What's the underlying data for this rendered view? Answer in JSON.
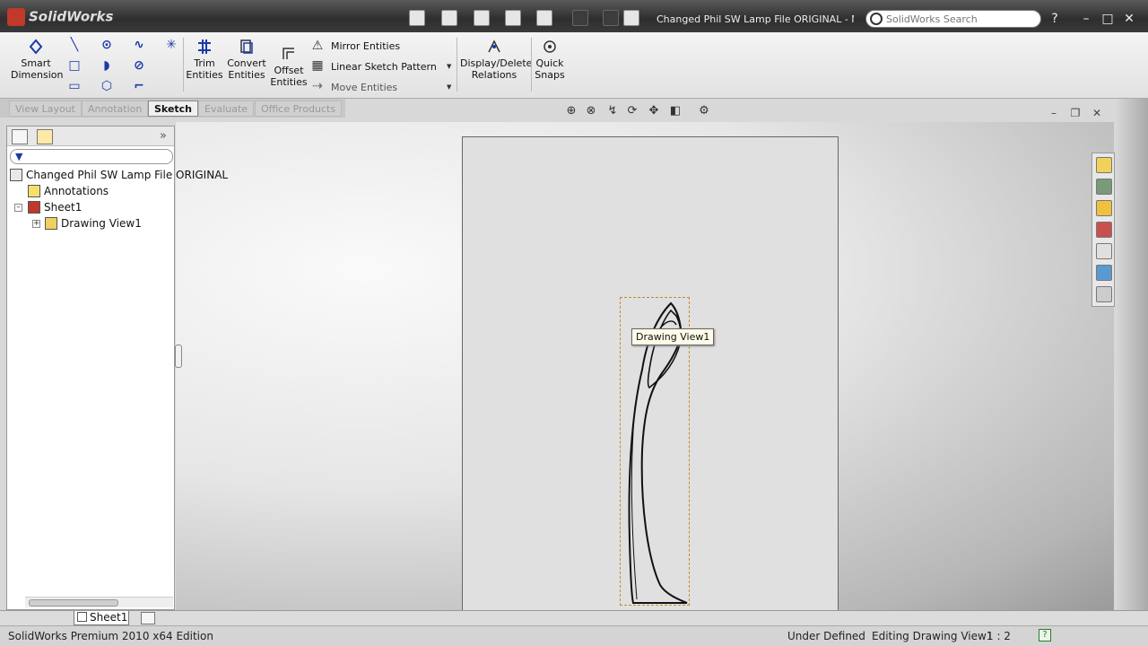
{
  "app": {
    "brand": "SolidWorks"
  },
  "titlebar": {
    "document_title": "Changed Phil SW Lamp File ORIGINAL - Milan...",
    "search_placeholder": "SolidWorks Search"
  },
  "ribbon": {
    "smart_dimension": "Smart\nDimension",
    "trim_entities": "Trim\nEntities",
    "convert_entities": "Convert\nEntities",
    "offset_entities": "Offset\nEntities",
    "mirror_entities": "Mirror Entities",
    "linear_sketch_pattern": "Linear Sketch Pattern",
    "move_entities": "Move Entities",
    "display_delete_relations": "Display/Delete\nRelations",
    "quick_snaps": "Quick\nSnaps"
  },
  "command_tabs": [
    {
      "label": "View Layout"
    },
    {
      "label": "Annotation"
    },
    {
      "label": "Sketch",
      "active": true
    },
    {
      "label": "Evaluate"
    },
    {
      "label": "Office Products"
    }
  ],
  "feature_tree": {
    "root": "Changed Phil SW Lamp File ORIGINAL",
    "items": [
      {
        "label": "Annotations"
      },
      {
        "label": "Sheet1"
      },
      {
        "label": "Drawing View1"
      }
    ]
  },
  "graphics": {
    "view_tooltip": "Drawing View1"
  },
  "sheet_tabs": [
    {
      "label": "Sheet1"
    }
  ],
  "status": {
    "edition": "SolidWorks Premium 2010 x64 Edition",
    "definition": "Under Defined",
    "editing": "Editing Drawing View1",
    "scale": "1 : 2"
  }
}
